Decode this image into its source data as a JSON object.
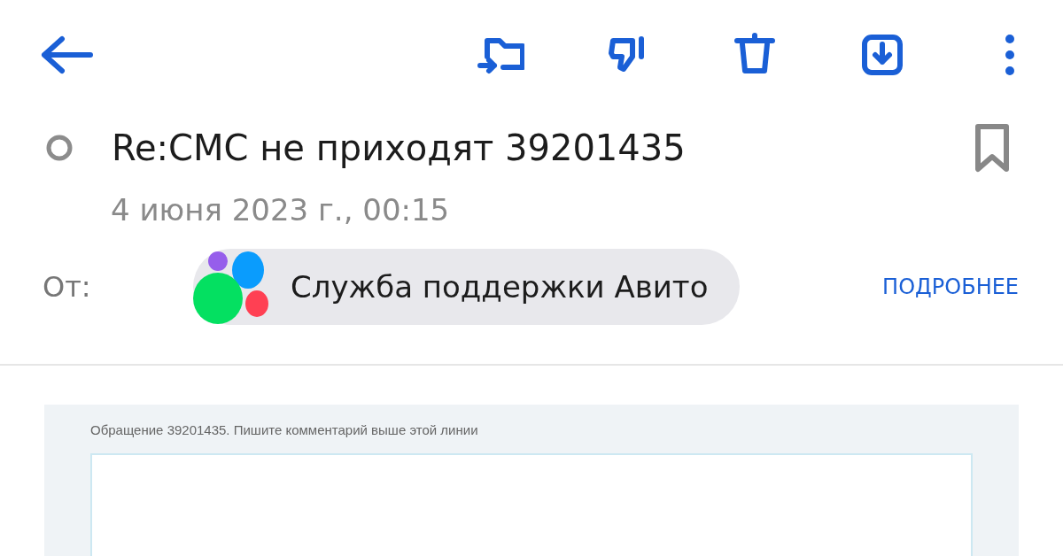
{
  "toolbar": {
    "actions": [
      {
        "kind": "move"
      },
      {
        "kind": "spam"
      },
      {
        "kind": "delete"
      },
      {
        "kind": "save"
      },
      {
        "kind": "more"
      }
    ]
  },
  "message": {
    "subject": "Re:СМС не приходят 39201435",
    "unread": false,
    "bookmarked": false,
    "date": "4 июня 2023 г., 00:15",
    "from_label": "От:",
    "sender": "Служба поддержки Авито",
    "details_link": "ПОДРОБНЕЕ"
  },
  "body": {
    "notice": "Обращение 39201435. Пишите комментарий выше этой линии"
  }
}
